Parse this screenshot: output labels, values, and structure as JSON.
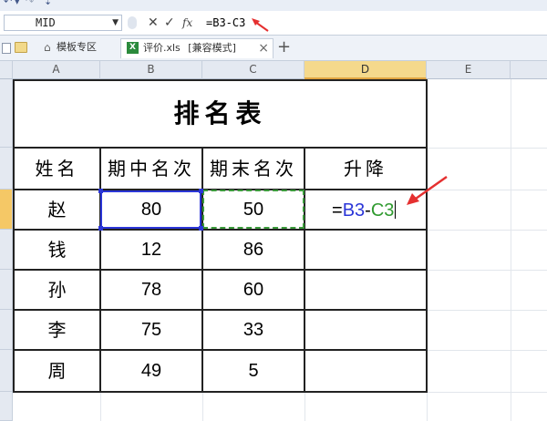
{
  "formula_bar": {
    "name_box": "MID",
    "formula": "=B3-C3",
    "cancel_symbol": "✕",
    "enter_symbol": "✓",
    "fx_symbol": "fx"
  },
  "tabs": [
    {
      "label": "模板专区"
    },
    {
      "label": "评价.xls",
      "mode": "[兼容模式]",
      "close": "×"
    }
  ],
  "new_tab_label": "+",
  "columns": [
    "A",
    "B",
    "C",
    "D",
    "E"
  ],
  "sheet": {
    "title": "排名表",
    "headers": [
      "姓名",
      "期中名次",
      "期末名次",
      "升降"
    ],
    "rows": [
      {
        "name": "赵",
        "mid": "80",
        "final": "50"
      },
      {
        "name": "钱",
        "mid": "12",
        "final": "86"
      },
      {
        "name": "孙",
        "mid": "78",
        "final": "60"
      },
      {
        "name": "李",
        "mid": "75",
        "final": "33"
      },
      {
        "name": "周",
        "mid": "49",
        "final": "5"
      }
    ],
    "editing": {
      "eq": "=",
      "ref1": "B3",
      "op": "-",
      "ref2": "C3"
    }
  },
  "colors": {
    "ref_blue": "#2b36d8",
    "ref_green": "#2f9a2f",
    "arrow_red": "#e53030",
    "selected_header": "#f5d98c"
  }
}
